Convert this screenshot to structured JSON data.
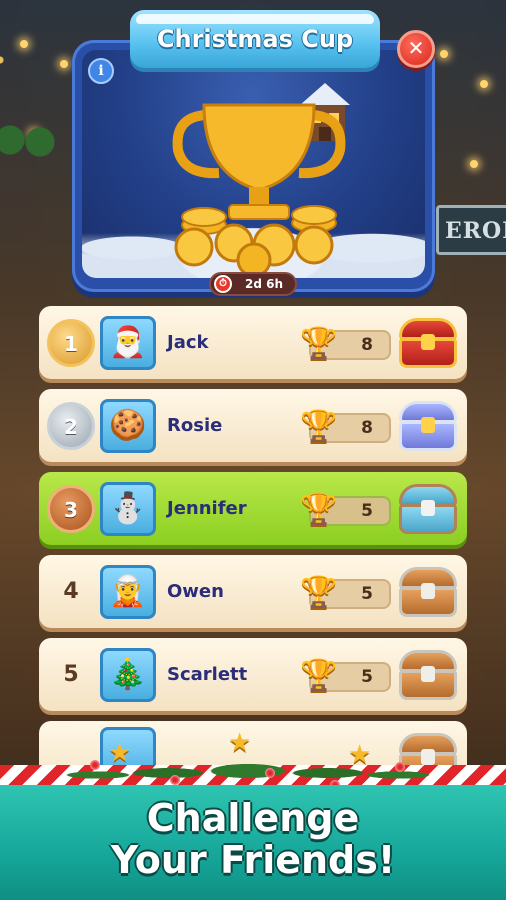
{
  "event": {
    "title": "Christmas Cup",
    "info_label": "i",
    "close_label": "✕",
    "timer": "2d 6h"
  },
  "leaderboard": [
    {
      "rank": "1",
      "name": "Jack",
      "score": "8",
      "avatar": "🎅",
      "reward": "red-chest"
    },
    {
      "rank": "2",
      "name": "Rosie",
      "score": "8",
      "avatar": "🍪",
      "reward": "silver-chest"
    },
    {
      "rank": "3",
      "name": "Jennifer",
      "score": "5",
      "avatar": "⛄",
      "reward": "teal-chest",
      "highlight": true
    },
    {
      "rank": "4",
      "name": "Owen",
      "score": "5",
      "avatar": "🧝",
      "reward": "wood-chest"
    },
    {
      "rank": "5",
      "name": "Scarlett",
      "score": "5",
      "avatar": "🎄",
      "reward": "wood-chest"
    }
  ],
  "icons": {
    "trophy": "🏆",
    "timer": "⏱",
    "star": "★"
  },
  "promo": {
    "line1": "Challenge",
    "line2": "Your Friends!"
  },
  "colors": {
    "card_blue": "#2a4fa8",
    "banner_cyan": "#56c1ef",
    "row_cream": "#fff7e6",
    "highlight_green": "#8ccf22",
    "name_navy": "#2a2e7a",
    "footer_teal": "#16a79a"
  }
}
